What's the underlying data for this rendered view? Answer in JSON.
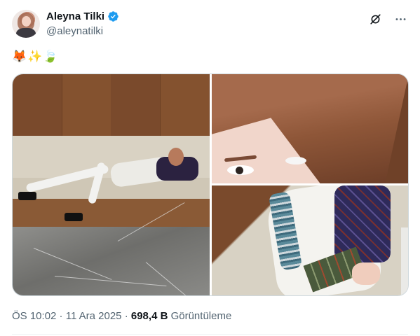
{
  "author": {
    "display_name": "Aleyna Tilki",
    "handle": "@aleynatilki",
    "verified_icon": "verified-badge-icon",
    "avatar_icon": "avatar-photo"
  },
  "actions": {
    "grok_icon": "grok-icon",
    "more_icon": "more-options-icon"
  },
  "tweet": {
    "text": "🦊✨🍃"
  },
  "media": {
    "image_count": 3,
    "images": [
      {
        "name": "photo-1"
      },
      {
        "name": "photo-2"
      },
      {
        "name": "photo-3"
      }
    ]
  },
  "meta": {
    "time": "ÖS 10:02",
    "separator1": " · ",
    "date": "11 Ara 2025",
    "separator2": " · ",
    "views_count": "698,4 B",
    "views_label": " Görüntüleme"
  },
  "colors": {
    "verified_blue": "#1d9bf0",
    "text_primary": "#0f1419",
    "text_secondary": "#536471",
    "border": "#cfd9de"
  }
}
